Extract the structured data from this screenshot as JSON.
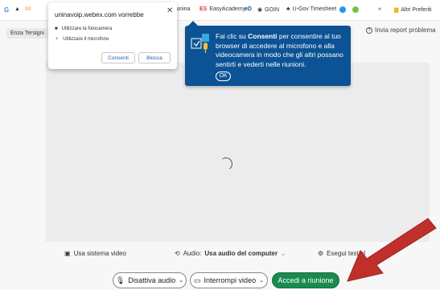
{
  "bookmarks": [
    {
      "label": "",
      "icon": "google-icon"
    },
    {
      "label": "",
      "icon": "drive-icon"
    },
    {
      "label": "",
      "icon": "analytics-icon"
    },
    {
      "label": "ec.unina",
      "icon": "site-icon"
    },
    {
      "label": "EasyAcademy",
      "icon": "easyacademy-icon"
    },
    {
      "label": "GOIN",
      "icon": "goin-icon"
    },
    {
      "label": "U-Gov Timesheet",
      "icon": "ugov-icon"
    },
    {
      "label": "",
      "icon": "blue-dot-icon"
    },
    {
      "label": "",
      "icon": "green-dot-icon"
    },
    {
      "label": "»",
      "icon": ""
    },
    {
      "label": "Altri Preferiti",
      "icon": "folder-icon"
    }
  ],
  "header": {
    "user_name": "Enza Tersigni",
    "report_label": "Invia report problema"
  },
  "permission_popup": {
    "title": "uninavoip.webex.com vorrebbe",
    "items": [
      "Utilizzare la fotocamera",
      "Utilizzare il microfono"
    ],
    "allow_label": "Consenti",
    "block_label": "Blocca"
  },
  "tooltip": {
    "text_before": "Fai clic su ",
    "text_bold": "Consenti",
    "text_after": " per consentire al tuo browser di accedere al microfono e alla videocamera in modo che gli altri possano sentirti e vederti nelle riunioni.",
    "ok_label": "OK"
  },
  "options": {
    "video_system": "Usa sistema video",
    "audio_prefix": "Audio: ",
    "audio_value": "Usa audio del computer",
    "test": "Esegui test al"
  },
  "buttons": {
    "mute_audio": "Disattiva audio",
    "stop_video": "Interrompi video",
    "join": "Accedi a riunione"
  },
  "colors": {
    "tooltip_bg": "#0b5394",
    "join_bg": "#1a8a4f",
    "arrow": "#c0302a"
  }
}
